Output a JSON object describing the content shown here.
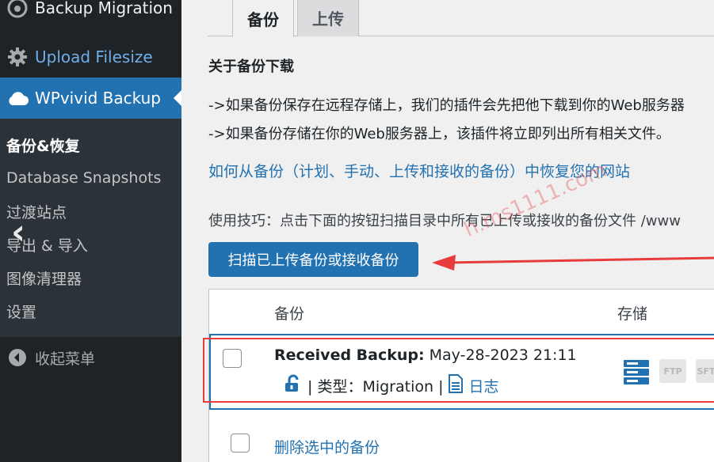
{
  "sidebar": {
    "items": [
      {
        "label": "Backup Migration",
        "icon": "backup-migration-icon"
      },
      {
        "label": "Upload Filesize",
        "icon": "gear-icon"
      },
      {
        "label": "WPvivid Backup",
        "icon": "cloud-icon"
      }
    ],
    "submenu": [
      "备份&恢复",
      "Database Snapshots",
      "过渡站点",
      "导出 & 导入",
      "图像清理器",
      "设置"
    ],
    "collapse_label": "收起菜单"
  },
  "tabs": [
    {
      "label": "备份"
    },
    {
      "label": "上传"
    }
  ],
  "about_title": "关于备份下载",
  "paragraphs": [
    "->如果备份保存在远程存储上，我们的插件会先把他下载到你的Web服务器",
    "->如果备份存储在你的Web服务器上，该插件将立即列出所有相关文件。"
  ],
  "restore_link": "如何从备份（计划、手动、上传和接收的备份）中恢复您的网站",
  "tip": "使用技巧：点击下面的按钮扫描目录中所有已上传或接收的备份文件 /www",
  "scan_button": "扫描已上传备份或接收备份",
  "watermark": "h.ms1111.com",
  "table": {
    "col_backup": "备份",
    "col_storage": "存储",
    "row": {
      "title_bold": "Received Backup:",
      "title_date": "May-28-2023 21:11",
      "type_text": "| 类型：Migration |",
      "log_label": "日志",
      "storage": [
        "server",
        "FTP",
        "SFTP"
      ]
    },
    "delete_label": "删除选中的备份"
  },
  "colors": {
    "accent": "#2271b1",
    "sidebar": "#1d2327",
    "highlight_red": "#e83b3b"
  }
}
